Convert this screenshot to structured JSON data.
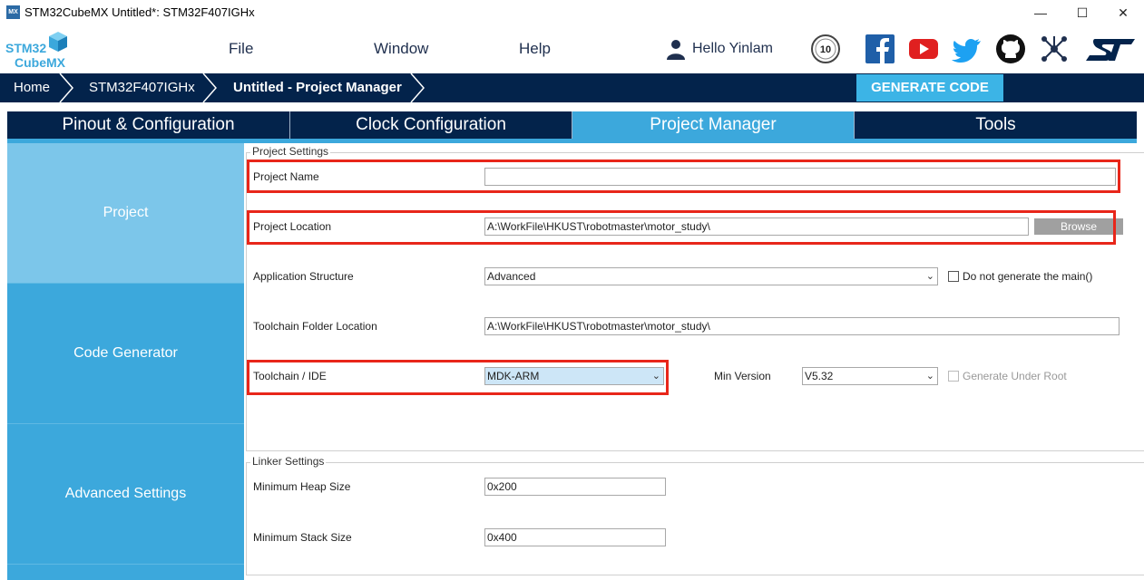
{
  "window": {
    "icon_text": "MX",
    "title": "STM32CubeMX Untitled*: STM32F407IGHx",
    "minimize": "—",
    "maximize": "☐",
    "close": "✕"
  },
  "logo": {
    "line1": "STM32",
    "line2": "CubeMX"
  },
  "menu": {
    "file": "File",
    "window": "Window",
    "help": "Help",
    "user": "Hello Yinlam"
  },
  "breadcrumb": {
    "home": "Home",
    "mcu": "STM32F407IGHx",
    "current": "Untitled - Project Manager"
  },
  "generate_code": "GENERATE CODE",
  "tabs": [
    {
      "label": "Pinout & Configuration"
    },
    {
      "label": "Clock Configuration"
    },
    {
      "label": "Project Manager"
    },
    {
      "label": "Tools"
    }
  ],
  "active_tab": 2,
  "nav": [
    {
      "label": "Project"
    },
    {
      "label": "Code Generator"
    },
    {
      "label": "Advanced Settings"
    }
  ],
  "project_settings": {
    "title": "Project Settings",
    "project_name_label": "Project Name",
    "project_name_value": "",
    "project_location_label": "Project Location",
    "project_location_value": "A:\\WorkFile\\HKUST\\robotmaster\\motor_study\\",
    "browse": "Browse",
    "app_structure_label": "Application Structure",
    "app_structure_value": "Advanced",
    "no_main_label": "Do not generate the main()",
    "toolchain_folder_label": "Toolchain Folder Location",
    "toolchain_folder_value": "A:\\WorkFile\\HKUST\\robotmaster\\motor_study\\",
    "toolchain_label": "Toolchain / IDE",
    "toolchain_value": "MDK-ARM",
    "min_version_label": "Min Version",
    "min_version_value": "V5.32",
    "generate_under_root_label": "Generate Under Root"
  },
  "linker_settings": {
    "title": "Linker Settings",
    "heap_label": "Minimum Heap Size",
    "heap_value": "0x200",
    "stack_label": "Minimum Stack Size",
    "stack_value": "0x400"
  },
  "colors": {
    "navy": "#03234b",
    "accent": "#3ca8dc",
    "highlight": "#e8261a"
  }
}
